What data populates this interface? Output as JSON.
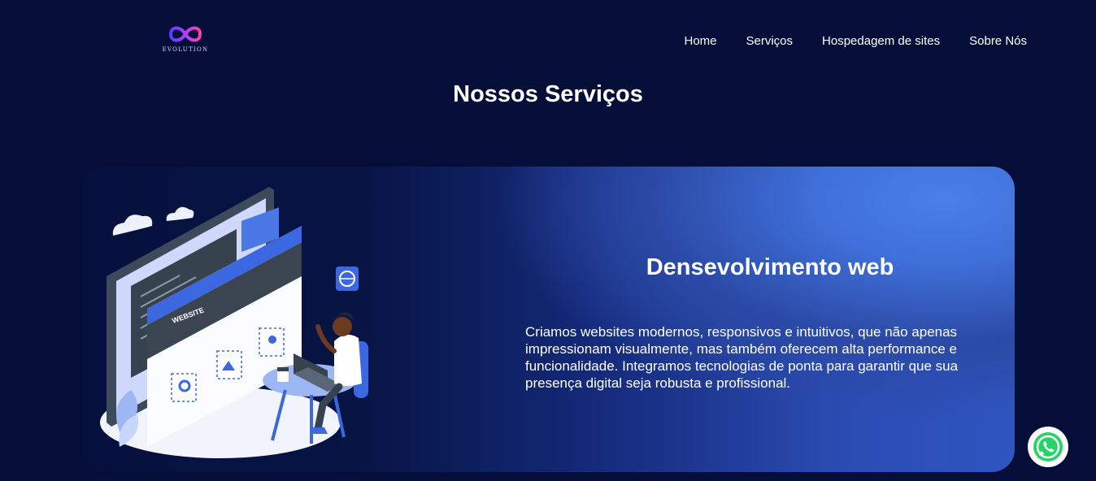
{
  "header": {
    "logo_text": "EVOLUTION",
    "nav": [
      {
        "label": "Home"
      },
      {
        "label": "Serviços"
      },
      {
        "label": "Hospedagem de sites"
      },
      {
        "label": "Sobre Nós"
      }
    ]
  },
  "section": {
    "title": "Nossos Serviços"
  },
  "card": {
    "illustration_text": "WEBSITE",
    "title": "Densevolvimento web",
    "description": "Criamos websites modernos, responsivos e intuitivos, que não apenas impressionam visualmente, mas também oferecem alta performance e funcionalidade. Integramos tecnologias de ponta para garantir que sua presença digital seja robusta e profissional."
  },
  "floating": {
    "whatsapp_icon": "whatsapp-icon"
  },
  "colors": {
    "background": "#040e38",
    "accent": "#4a7fe9",
    "whatsapp_green": "#25d366"
  }
}
